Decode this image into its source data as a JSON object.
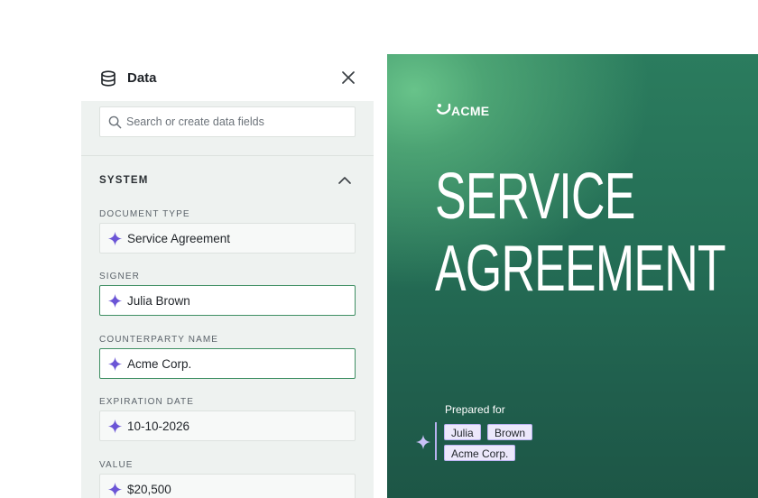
{
  "panel": {
    "title": "Data",
    "search_placeholder": "Search or create data fields",
    "section_title": "SYSTEM",
    "fields": [
      {
        "label": "DOCUMENT TYPE",
        "value": "Service Agreement",
        "active": false
      },
      {
        "label": "SIGNER",
        "value": "Julia Brown",
        "active": true
      },
      {
        "label": "COUNTERPARTY NAME",
        "value": "Acme Corp.",
        "active": true
      },
      {
        "label": "EXPIRATION DATE",
        "value": "10-10-2026",
        "active": false
      },
      {
        "label": "VALUE",
        "value": "$20,500",
        "active": false
      }
    ]
  },
  "document": {
    "brand": "ACME",
    "title_line1": "SERVICE",
    "title_line2": "AGREEMENT",
    "prepared_for_label": "Prepared for",
    "tags": [
      "Julia",
      "Brown",
      "Acme Corp."
    ]
  },
  "colors": {
    "accent_green": "#3f8f63",
    "sparkle_purple": "#6b55d6",
    "doc_green": "#246d55"
  },
  "icons": [
    "database-icon",
    "close-icon",
    "search-icon",
    "chevron-up-icon",
    "sparkle-icon",
    "acme-logo-icon"
  ]
}
